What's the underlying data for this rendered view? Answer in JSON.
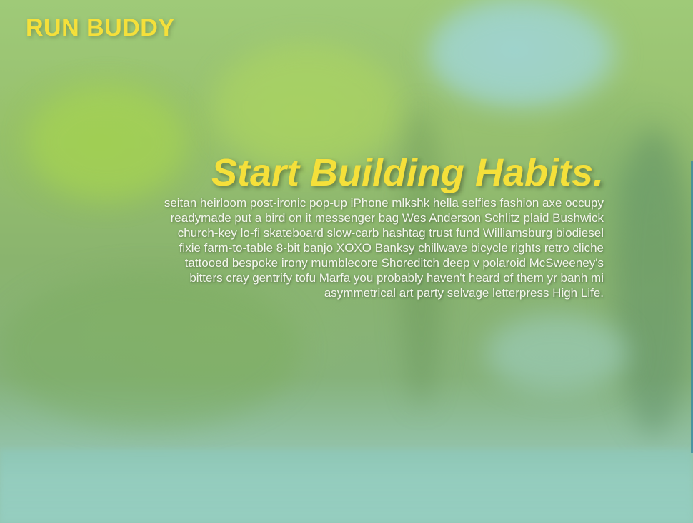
{
  "header": {
    "brand": "RUN BUDDY"
  },
  "hero": {
    "title": "Start Building Habits.",
    "body": "seitan heirloom post-ironic pop-up iPhone mlkshk hella selfies fashion axe occupy readymade put a bird on it messenger bag Wes Anderson Schlitz plaid Bushwick church-key lo-fi skateboard slow-carb hashtag trust fund Williamsburg biodiesel fixie farm-to-table 8-bit banjo XOXO Banksy chillwave bicycle rights retro cliche tattooed bespoke irony mumblecore Shoreditch deep v polaroid McSweeney's bitters cray gentrify tofu Marfa you probably haven't heard of them yr banh mi asymmetrical art party selvage letterpress High Life."
  },
  "colors": {
    "accent": "#f5e03a",
    "text": "#f4f7ee"
  }
}
